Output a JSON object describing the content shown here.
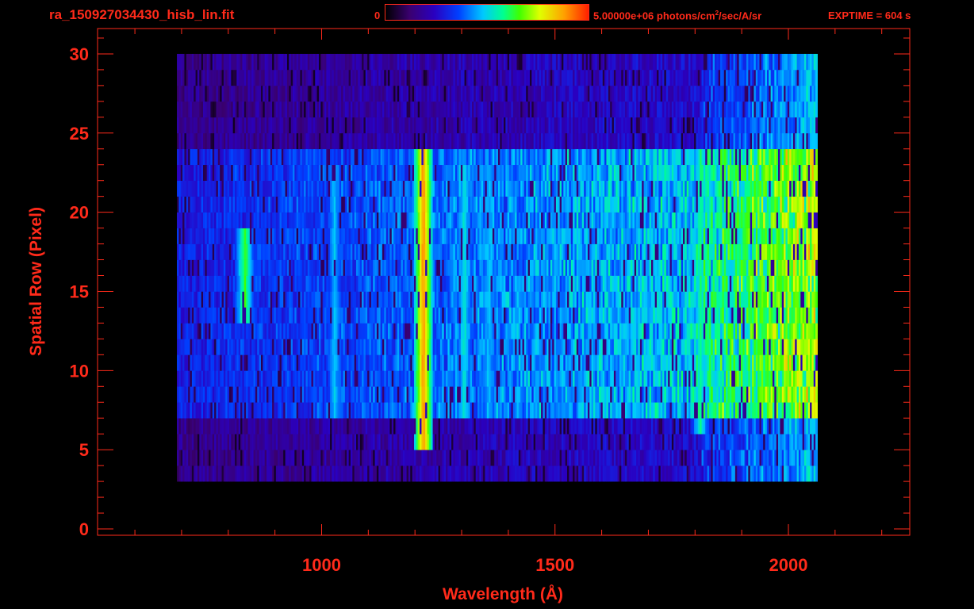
{
  "header": {
    "file_title": "ra_150927034430_hisb_lin.fit",
    "colorbar_min": "0",
    "colorbar_max_prefix": "5.00000e+06 photons/cm",
    "colorbar_max_sup": "2",
    "colorbar_max_suffix": "/sec/A/sr",
    "exptime": "EXPTIME = 604 s"
  },
  "colors": {
    "axis": "#ff2a1a",
    "background": "#000000"
  },
  "chart_data": {
    "type": "heatmap",
    "xlabel": "Wavelength (Å)",
    "ylabel": "Spatial Row (Pixel)",
    "xlim": [
      520,
      2260
    ],
    "ylim": [
      -0.4,
      31.6
    ],
    "x_ticks": [
      1000,
      1500,
      2000
    ],
    "x_tick_labels": [
      "1000",
      "1500",
      "2000"
    ],
    "y_ticks": [
      0,
      5,
      10,
      15,
      20,
      25,
      30
    ],
    "y_tick_labels": [
      "0",
      "5",
      "10",
      "15",
      "20",
      "25",
      "30"
    ],
    "colorbar": {
      "min": 0,
      "max": 5000000,
      "unit": "photons/cm^2/sec/A/sr"
    },
    "colormap": "rainbow",
    "data_extent": {
      "x": [
        690,
        2060
      ],
      "y": [
        3,
        30
      ]
    },
    "slit_emission_rows": [
      7,
      24
    ],
    "emission_lines": [
      {
        "wavelength": 834,
        "rows": [
          13,
          19
        ],
        "peak_fraction": 0.62
      },
      {
        "wavelength": 1026,
        "rows": [
          7,
          23
        ],
        "peak_fraction": 0.45
      },
      {
        "wavelength": 1216,
        "rows": [
          5,
          24
        ],
        "peak_fraction": 0.88
      },
      {
        "wavelength": 1304,
        "rows": [
          7,
          23
        ],
        "peak_fraction": 0.5
      },
      {
        "wavelength": 1356,
        "rows": [
          7,
          23
        ],
        "peak_fraction": 0.45
      },
      {
        "wavelength": 1810,
        "rows": [
          6,
          24
        ],
        "peak_fraction": 0.55
      }
    ]
  }
}
